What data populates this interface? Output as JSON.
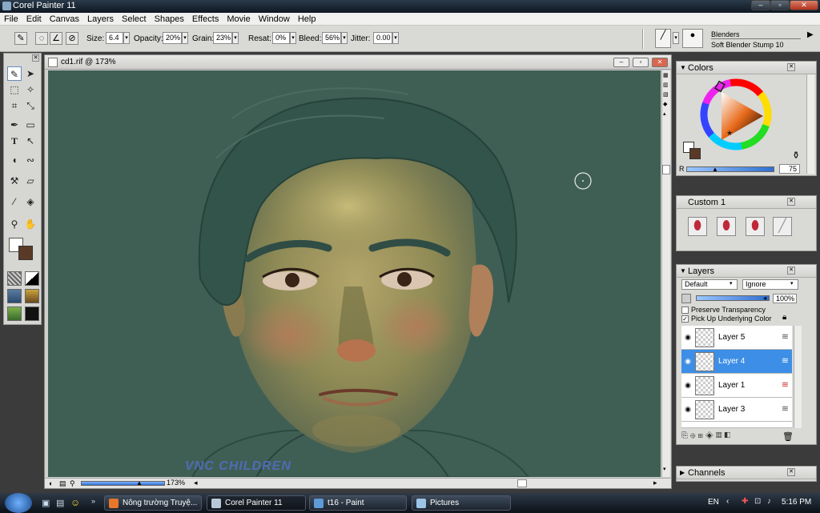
{
  "window": {
    "title": "Corel Painter 11",
    "min_glyph": "‒",
    "max_glyph": "▫",
    "close_glyph": "✕"
  },
  "menu": [
    "File",
    "Edit",
    "Canvas",
    "Layers",
    "Select",
    "Shapes",
    "Effects",
    "Movie",
    "Window",
    "Help"
  ],
  "property_bar": {
    "size_label": "Size:",
    "size_value": "6.4",
    "opacity_label": "Opacity:",
    "opacity_value": "20%",
    "grain_label": "Grain:",
    "grain_value": "23%",
    "resat_label": "Resat:",
    "resat_value": "0%",
    "bleed_label": "Bleed:",
    "bleed_value": "56%",
    "jitter_label": "Jitter:",
    "jitter_value": "0.00",
    "brush_category": "Blenders",
    "brush_variant": "Soft Blender Stump 10"
  },
  "document": {
    "title": "cd1.rif @ 173%",
    "zoom": "173%",
    "signature": "VNC CHILDREN"
  },
  "colors_panel": {
    "title": "Colors",
    "r_label": "R",
    "r_value": "75",
    "main_color": "#ffffff",
    "additional_color": "#5a3a26"
  },
  "custom_panel": {
    "title": "Custom  1"
  },
  "layers_panel": {
    "title": "Layers",
    "composite_method": "Default",
    "composite_depth": "Ignore",
    "opacity": "100%",
    "preserve_transparency": "Preserve Transparency",
    "pick_up_color": "Pick Up Underlying Color",
    "layers": [
      "Layer 5",
      "Layer 4",
      "Layer 1",
      "Layer 3"
    ],
    "active_layer": "Layer 4"
  },
  "channels_panel": {
    "title": "Channels"
  },
  "taskbar": {
    "items": [
      "Nông trường Truyệ...",
      "Corel Painter 11",
      "t16 - Paint",
      "Pictures"
    ],
    "language": "EN",
    "time": "5:16 PM"
  }
}
